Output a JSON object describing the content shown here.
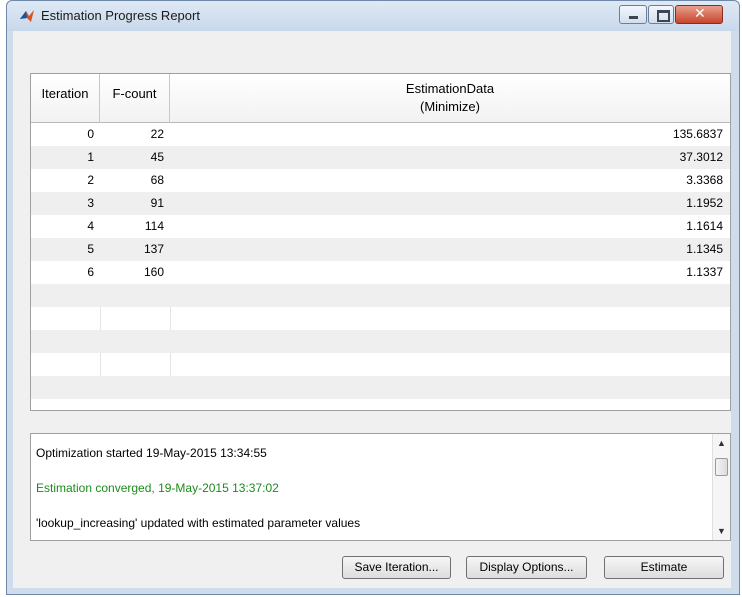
{
  "window": {
    "title": "Estimation Progress Report",
    "close_glyph": "✕"
  },
  "table": {
    "headers": {
      "iteration": "Iteration",
      "fcount": "F-count",
      "estimation_data": "EstimationData",
      "estimation_sub": "(Minimize)"
    },
    "rows": [
      {
        "iteration": "0",
        "fcount": "22",
        "value": "135.6837"
      },
      {
        "iteration": "1",
        "fcount": "45",
        "value": "37.3012"
      },
      {
        "iteration": "2",
        "fcount": "68",
        "value": "3.3368"
      },
      {
        "iteration": "3",
        "fcount": "91",
        "value": "1.1952"
      },
      {
        "iteration": "4",
        "fcount": "114",
        "value": "1.1614"
      },
      {
        "iteration": "5",
        "fcount": "137",
        "value": "1.1345"
      },
      {
        "iteration": "6",
        "fcount": "160",
        "value": "1.1337"
      }
    ]
  },
  "log": {
    "lines": [
      {
        "text": "Optimization started 19-May-2015 13:34:55",
        "color": "#000000"
      },
      {
        "text": "Estimation converged, 19-May-2015 13:37:02",
        "color": "#1c8c1c"
      },
      {
        "text": "'lookup_increasing' updated with estimated parameter values",
        "color": "#000000"
      }
    ],
    "scroll_up_icon": "▲",
    "scroll_down_icon": "▼"
  },
  "buttons": {
    "save_iteration": "Save Iteration...",
    "display_options": "Display Options...",
    "estimate": "Estimate"
  },
  "colors": {
    "converged_text": "#1c8c1c",
    "title_bar": "#cfdcec",
    "close_button": "#c8442c"
  },
  "icons": {
    "app": "matlab-icon",
    "minimize": "minimize-icon",
    "maximize": "maximize-icon",
    "close": "close-icon"
  }
}
